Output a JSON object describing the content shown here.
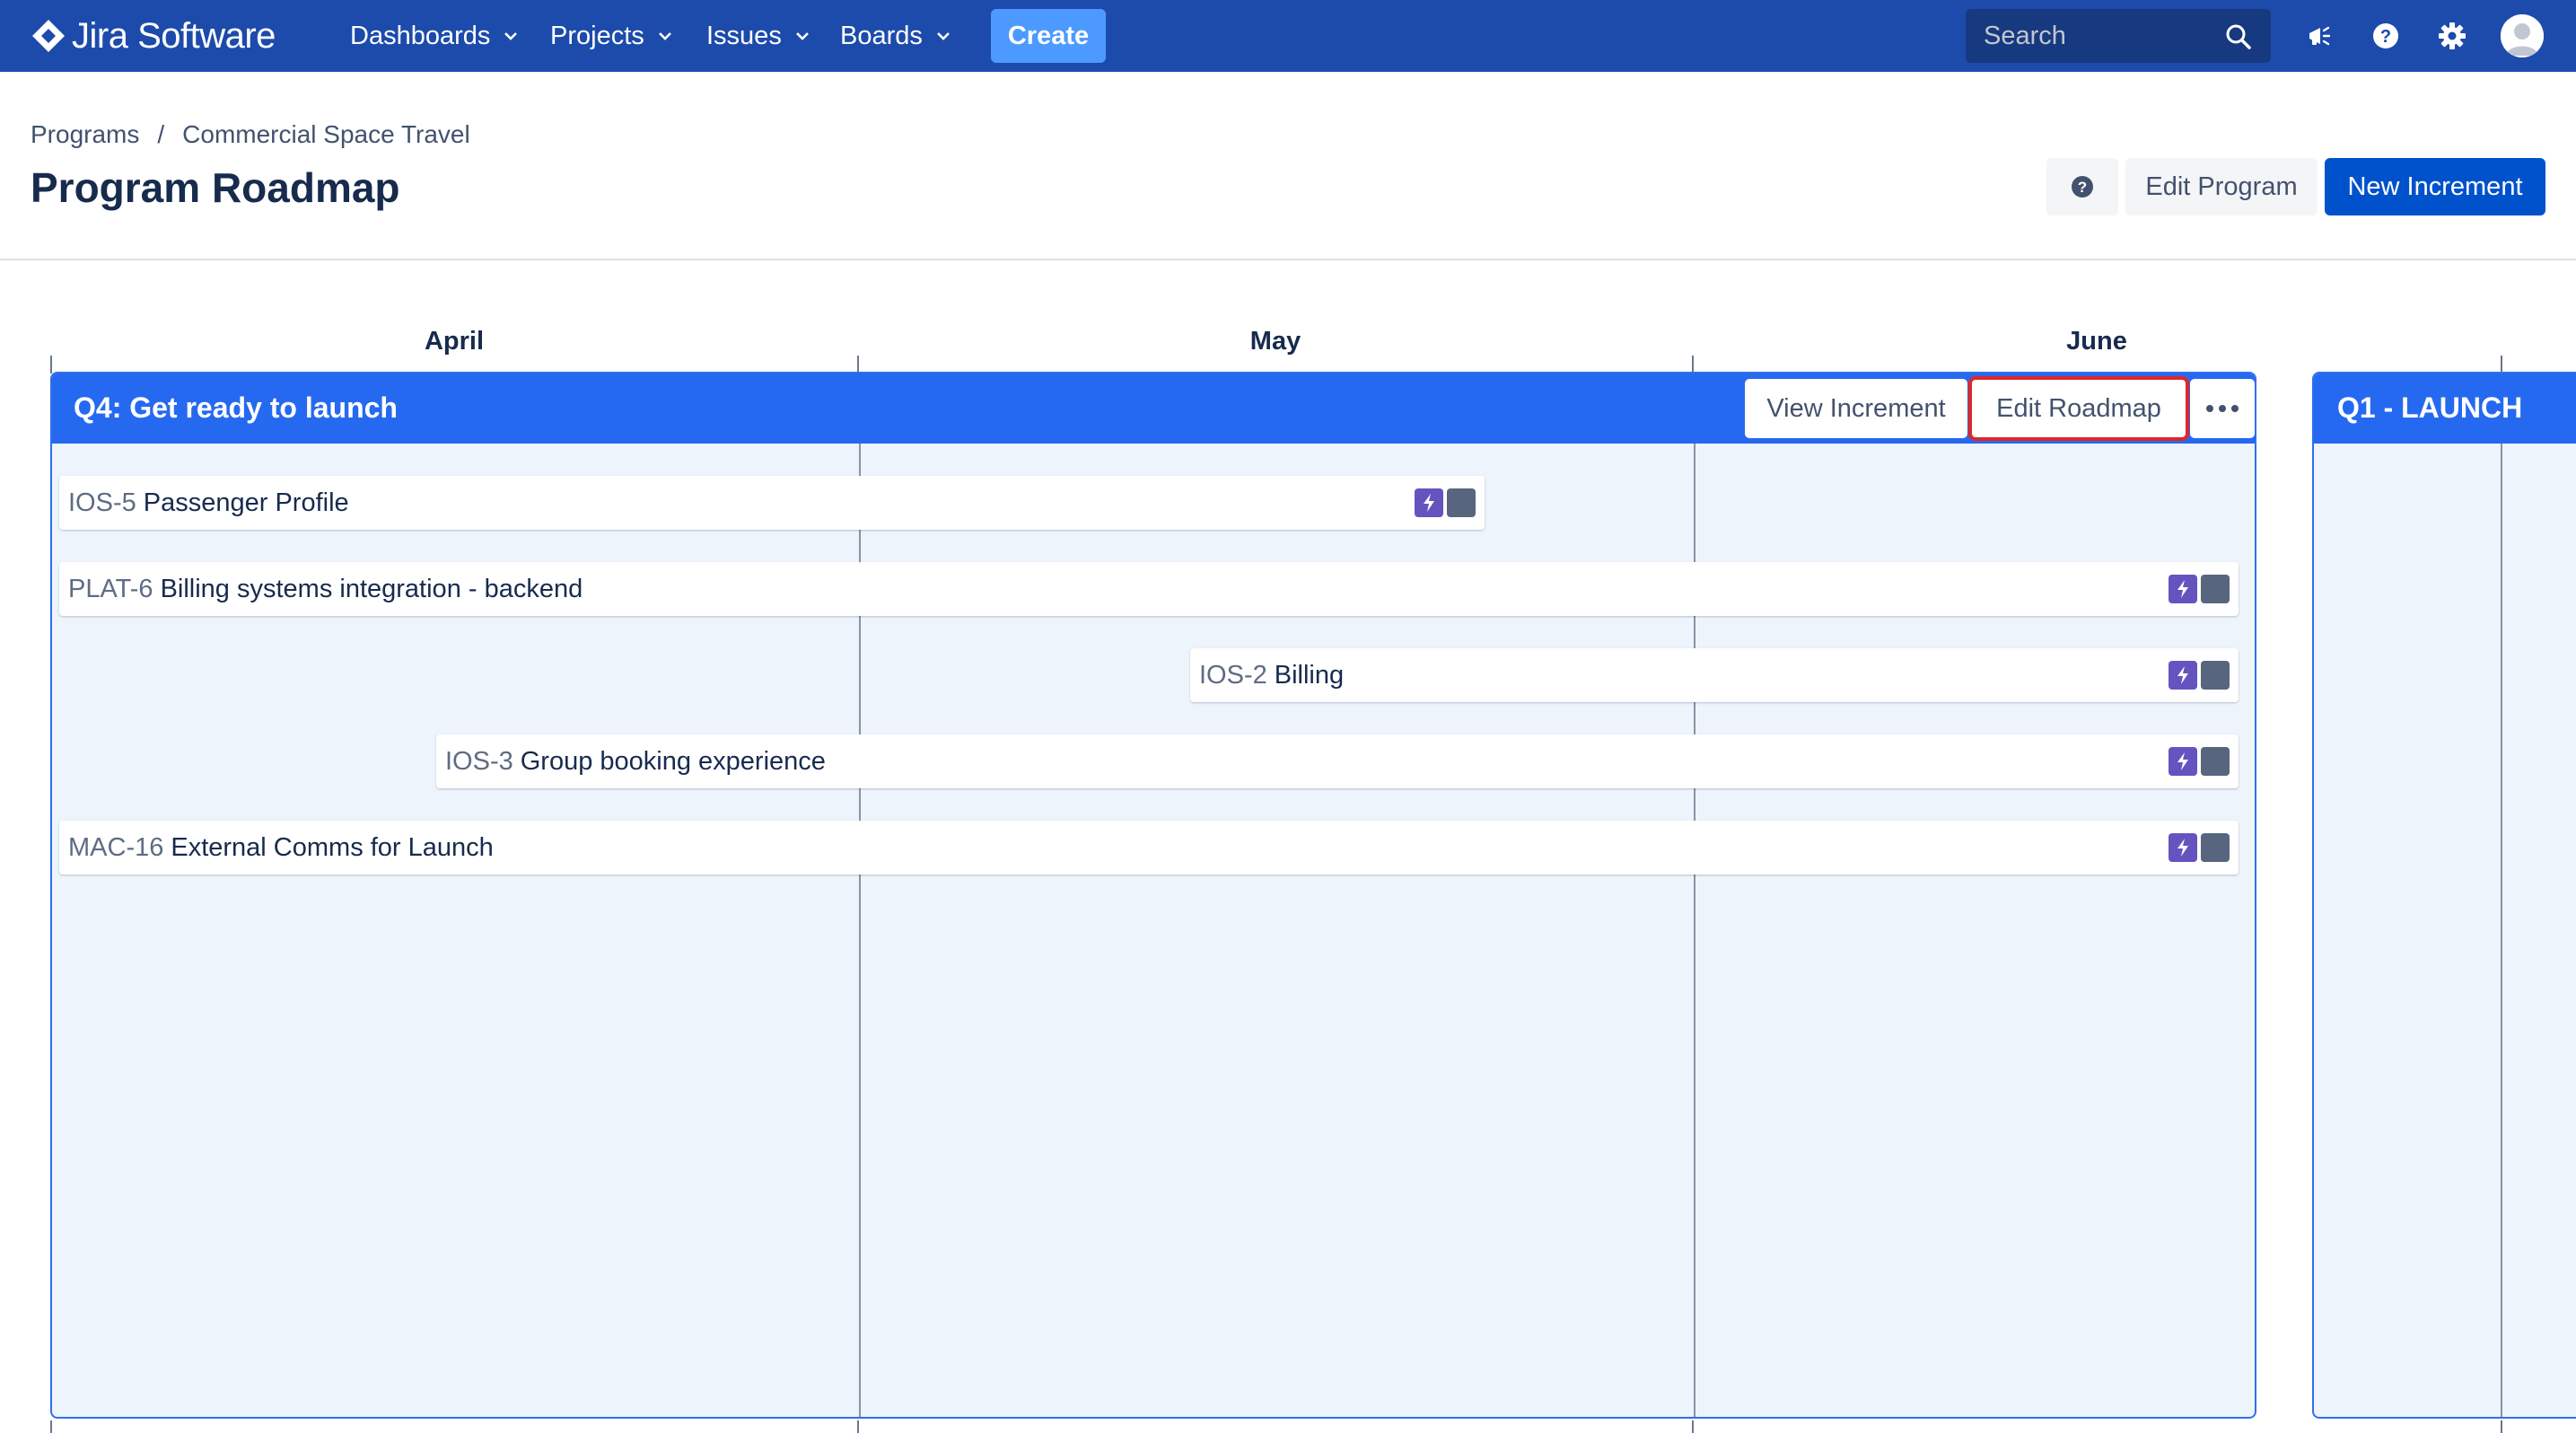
{
  "app": {
    "logo_text": "Jira Software"
  },
  "nav": {
    "items": [
      {
        "label": "Dashboards"
      },
      {
        "label": "Projects"
      },
      {
        "label": "Issues"
      },
      {
        "label": "Boards"
      }
    ],
    "create_label": "Create",
    "search_placeholder": "Search",
    "icons": [
      "announcements-icon",
      "help-icon",
      "settings-icon",
      "avatar"
    ]
  },
  "breadcrumb": [
    "Programs",
    "Commercial Space Travel"
  ],
  "page": {
    "title": "Program Roadmap",
    "edit_program_label": "Edit Program",
    "new_increment_label": "New Increment"
  },
  "timeline": {
    "months": [
      "April",
      "May",
      "June"
    ]
  },
  "increments": [
    {
      "title": "Q4: Get ready to launch",
      "view_label": "View Increment",
      "edit_label": "Edit Roadmap",
      "items": [
        {
          "key": "IOS-5",
          "summary": "Passenger Profile"
        },
        {
          "key": "PLAT-6",
          "summary": "Billing systems integration - backend"
        },
        {
          "key": "IOS-2",
          "summary": "Billing"
        },
        {
          "key": "IOS-3",
          "summary": "Group booking experience"
        },
        {
          "key": "MAC-16",
          "summary": "External Comms for Launch"
        }
      ]
    },
    {
      "title": "Q1 - LAUNCH"
    }
  ],
  "colors": {
    "nav_bg": "#1d4bab",
    "create_bg": "#4c9aff",
    "increment_header": "#2669f1",
    "primary_button": "#0052cc",
    "epic_icon": "#6554c0",
    "highlight_outline": "#e02727"
  }
}
